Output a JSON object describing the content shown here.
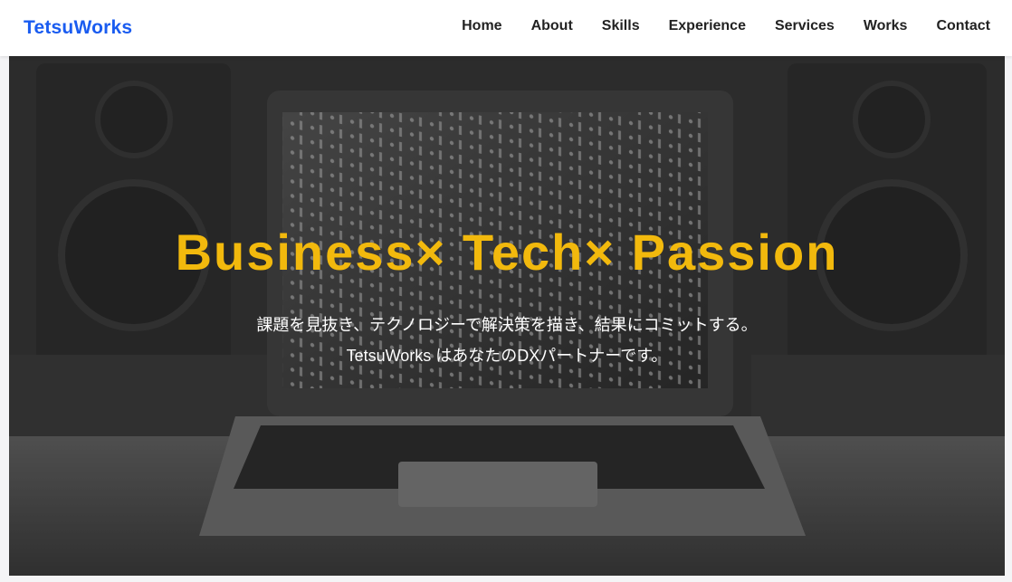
{
  "nav": {
    "logo": "TetsuWorks",
    "links": [
      "Home",
      "About",
      "Skills",
      "Experience",
      "Services",
      "Works",
      "Contact"
    ]
  },
  "hero": {
    "headline": "Business× Tech× Passion",
    "subline1": "課題を見抜き、テクノロジーで解決策を描き、結果にコミットする。",
    "subline2": "TetsuWorks はあなたのDXパートナーです。"
  },
  "colors": {
    "brand": "#1a5cf0",
    "accent": "#f2b90d",
    "hero_bg": "#3f3e3f"
  }
}
